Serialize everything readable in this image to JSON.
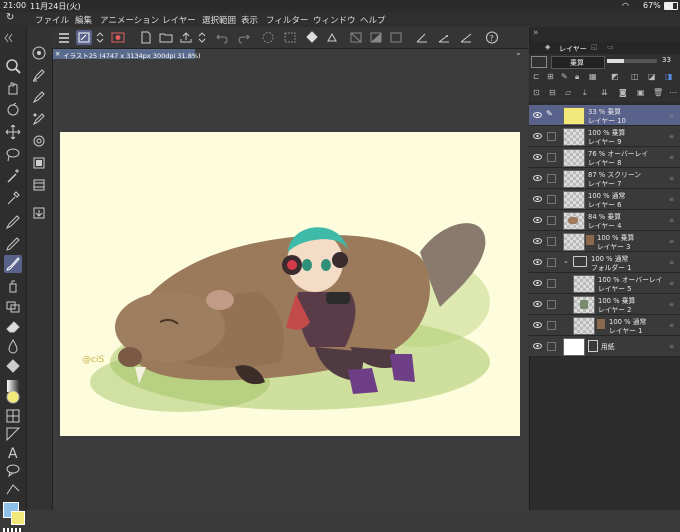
{
  "status_bar": {
    "time": "21:00",
    "date": "11月24日(火)",
    "battery": "67%"
  },
  "menu": [
    "ファイル",
    "編集",
    "アニメーション",
    "レイヤー",
    "選択範囲",
    "表示",
    "フィルター",
    "ウィンドウ",
    "ヘルプ"
  ],
  "document_tab": {
    "title": "イラスト25 (4747 x 3134px 300dpi 31.8%)"
  },
  "canvas": {
    "signature": "@ciS"
  },
  "layer_panel": {
    "tab_label": "レイヤー",
    "blend_mode": "乗算",
    "opacity_value": "33",
    "layers": [
      {
        "line1": "33 % 乗算",
        "line2": "レイヤー 10"
      },
      {
        "line1": "100 % 乗算",
        "line2": "レイヤー 9"
      },
      {
        "line1": "76 % オーバーレイ",
        "line2": "レイヤー 8"
      },
      {
        "line1": "87 % スクリーン",
        "line2": "レイヤー 7"
      },
      {
        "line1": "100 % 通常",
        "line2": "レイヤー 6"
      },
      {
        "line1": "84 % 乗算",
        "line2": "レイヤー 4"
      },
      {
        "line1": "100 % 乗算",
        "line2": "レイヤー 3"
      },
      {
        "line1": "100 % 通常",
        "line2": "フォルダー 1"
      },
      {
        "line1": "100 % オーバーレイ",
        "line2": "レイヤー 5"
      },
      {
        "line1": "100 % 乗算",
        "line2": "レイヤー 2"
      },
      {
        "line1": "100 % 通常",
        "line2": "レイヤー 1"
      },
      {
        "line1": "",
        "line2": "用紙"
      }
    ]
  },
  "colors": {
    "accent": "#5a6a8c",
    "selected_layer": "#58628a",
    "main_color": "#f3e97a",
    "sub_color": "#8ec0e8"
  }
}
